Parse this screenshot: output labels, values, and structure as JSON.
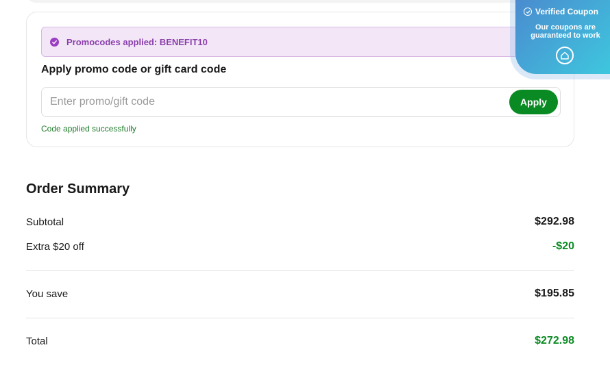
{
  "promo": {
    "applied_text": "Promocodes applied: BENEFIT10",
    "title": "Apply promo code or gift card code",
    "input_value": "",
    "input_placeholder": "Enter promo/gift code",
    "apply_label": "Apply",
    "success_text": "Code applied successfully"
  },
  "summary": {
    "title": "Order Summary",
    "rows": [
      {
        "label": "Subtotal",
        "value": "$292.98"
      },
      {
        "label": "Extra $20 off",
        "value": "-$20"
      },
      {
        "label": "You save",
        "value": "$195.85"
      },
      {
        "label": "Total",
        "value": "$272.98"
      }
    ]
  },
  "coupon_widget": {
    "title": "Verified Coupon",
    "subtitle_line1": "Our coupons are",
    "subtitle_line2": "guaranteed to work"
  },
  "colors": {
    "brand_green": "#0a8a22",
    "purple_accent": "#8a3fab",
    "widget_blue": "#4a8bcf",
    "widget_cyan": "#3ec7de"
  },
  "icons": {
    "applied": "check-circle-icon",
    "close": "close-icon",
    "coupon_check": "check-circle-icon",
    "coupon_logo": "house-logo-icon"
  }
}
